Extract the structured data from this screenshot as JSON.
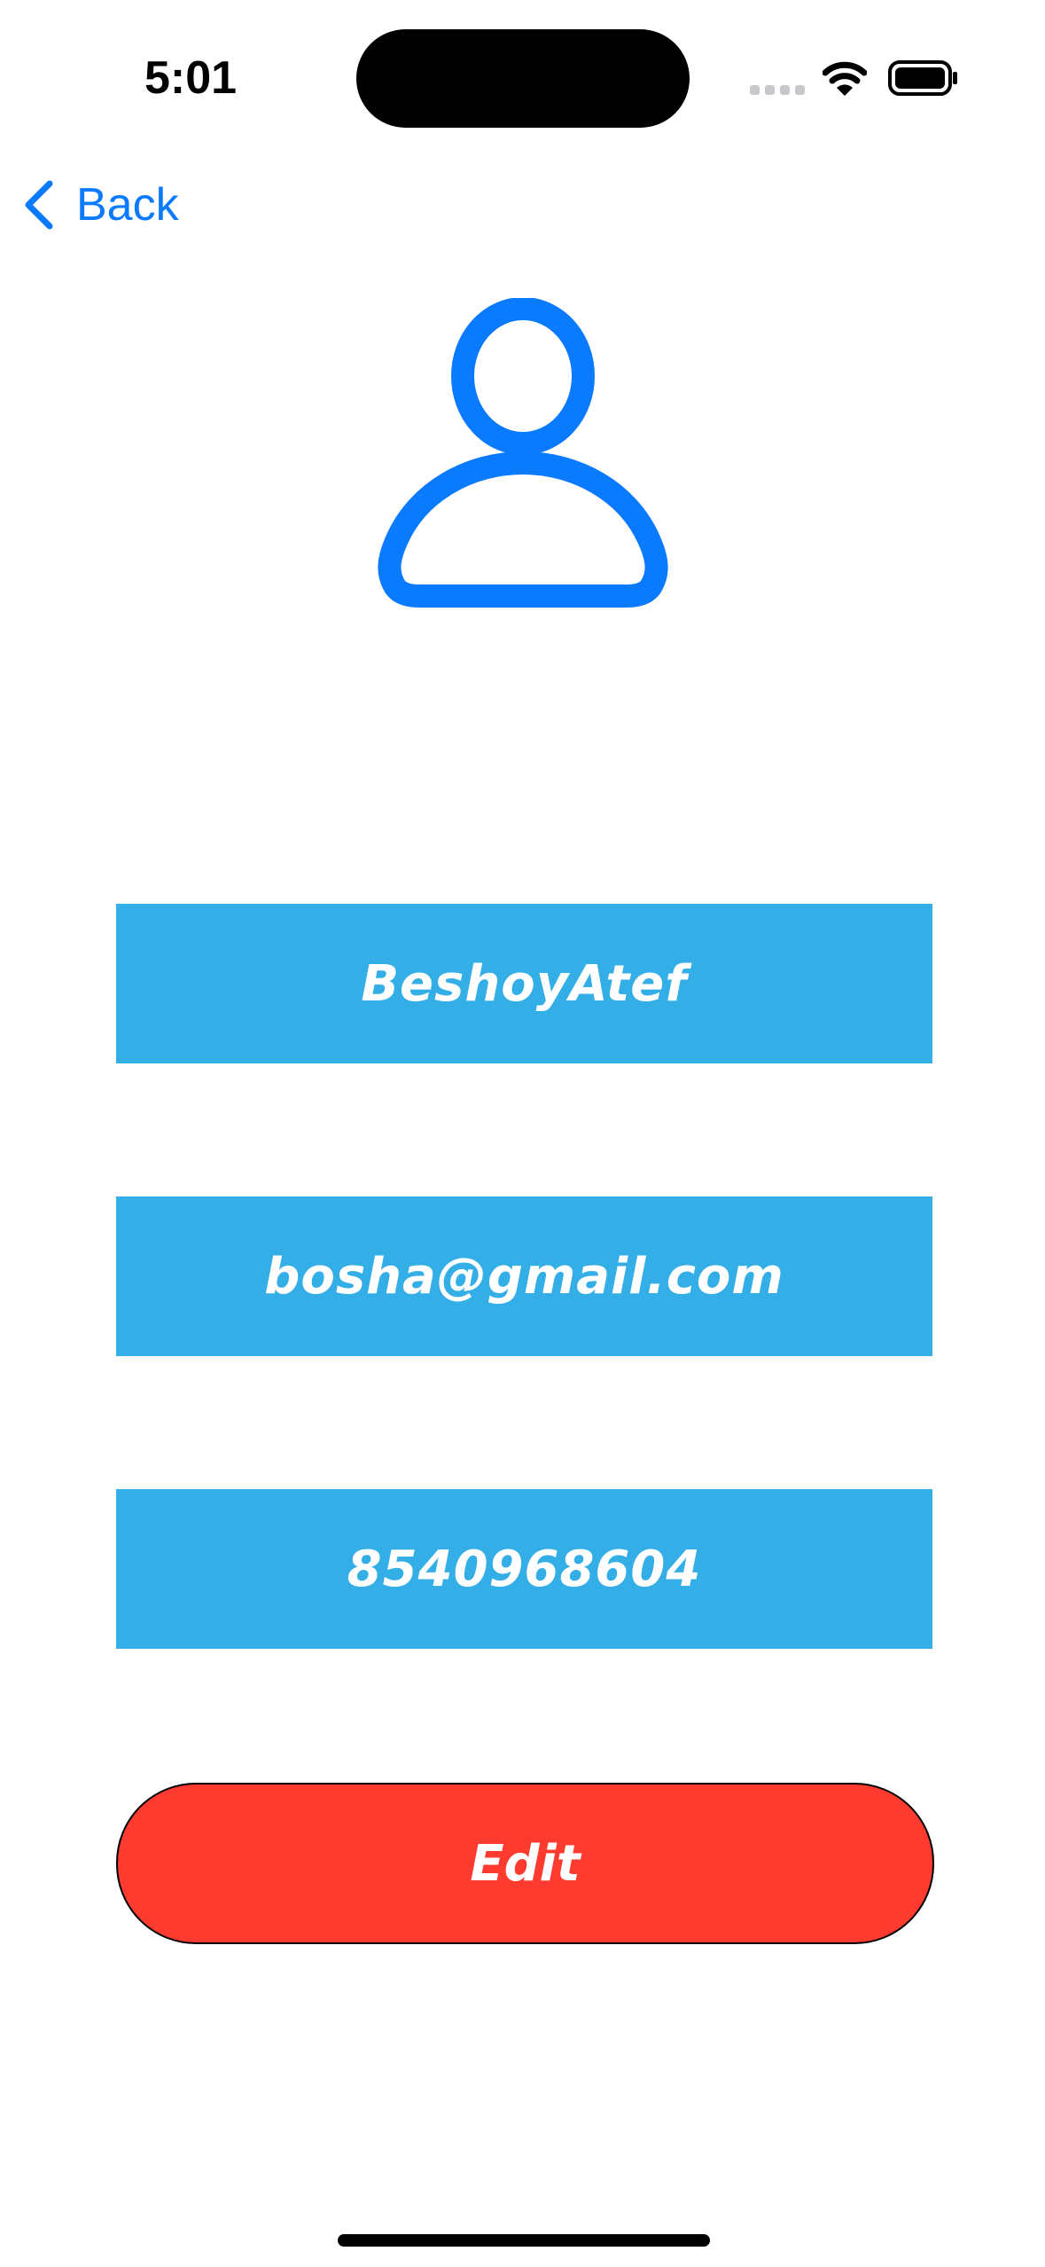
{
  "status_bar": {
    "time": "5:01",
    "icons": [
      "signal-dots-icon",
      "wifi-icon",
      "battery-icon"
    ]
  },
  "nav": {
    "back_label": "Back",
    "back_icon": "chevron-left-icon"
  },
  "profile": {
    "avatar_icon": "person-icon",
    "name": "BeshoyAtef",
    "email": "bosha@gmail.com",
    "phone": "8540968604"
  },
  "actions": {
    "edit_label": "Edit"
  },
  "colors": {
    "accent": "#0a7aff",
    "field_background": "#34aee6",
    "edit_button": "#ff3b30",
    "text_on_fill": "#ffffff"
  }
}
